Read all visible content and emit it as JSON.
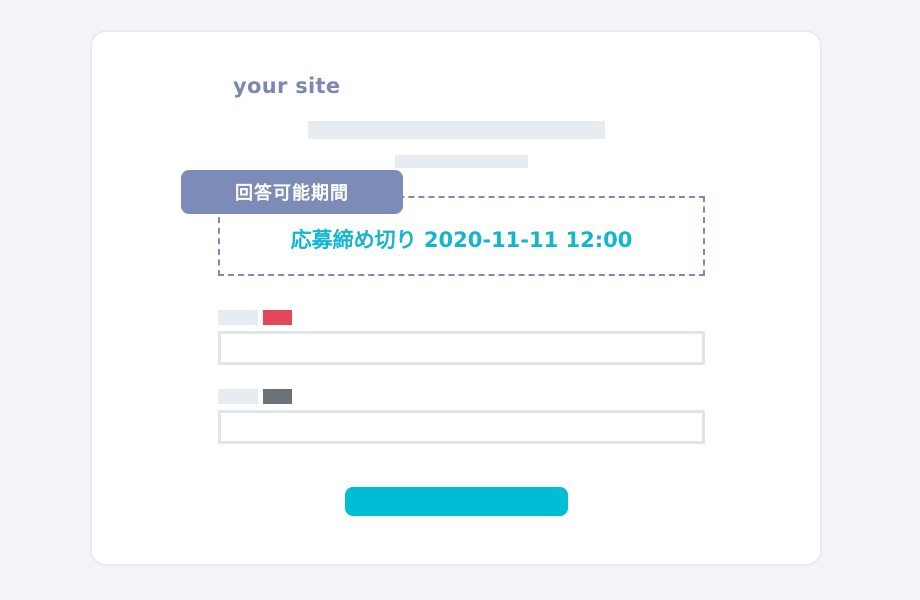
{
  "site": {
    "name": "your site"
  },
  "period": {
    "tag_label": "回答可能期間",
    "deadline_text": "応募締め切り 2020-11-11 12:00"
  },
  "form": {
    "fields": [
      {
        "badge_color": "#e5475a"
      },
      {
        "badge_color": "#6b7278"
      }
    ],
    "submit_color": "#00bdd6"
  },
  "colors": {
    "background": "#f3f4f9",
    "accent": "#13b5cf",
    "tag": "#7d8bb8",
    "placeholder": "#e6ecef"
  }
}
